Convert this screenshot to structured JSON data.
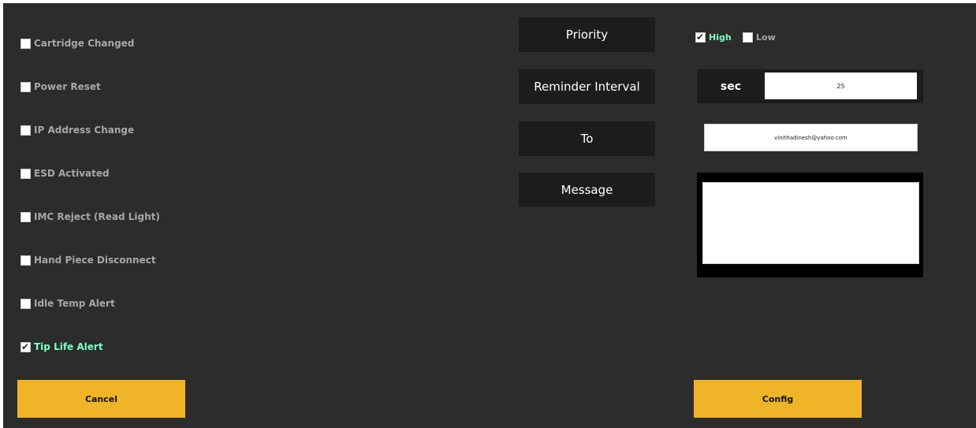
{
  "alerts": [
    {
      "label": "Cartridge Changed",
      "checked": false
    },
    {
      "label": "Power Reset",
      "checked": false
    },
    {
      "label": "IP Address Change",
      "checked": false
    },
    {
      "label": "ESD Activated",
      "checked": false
    },
    {
      "label": "IMC Reject (Read Light)",
      "checked": false
    },
    {
      "label": "Hand Piece Disconnect",
      "checked": false
    },
    {
      "label": "Idle Temp Alert",
      "checked": false
    },
    {
      "label": "Tip Life Alert",
      "checked": true
    }
  ],
  "fields": {
    "priority_label": "Priority",
    "interval_label": "Reminder Interval",
    "to_label": "To",
    "message_label": "Message"
  },
  "priority": {
    "high_label": "High",
    "high_checked": true,
    "low_label": "Low",
    "low_checked": false
  },
  "interval": {
    "unit": "sec",
    "value": "25"
  },
  "to": {
    "value": "vinithadinesh@yahoo.com"
  },
  "message": {
    "value": ""
  },
  "buttons": {
    "cancel": "Cancel",
    "config": "Config"
  },
  "colors": {
    "background": "#2c2c2c",
    "label_bg": "#1c1c1c",
    "checked_text": "#7fffc4",
    "unchecked_text": "#a7a7a7",
    "button": "#f0b429"
  }
}
